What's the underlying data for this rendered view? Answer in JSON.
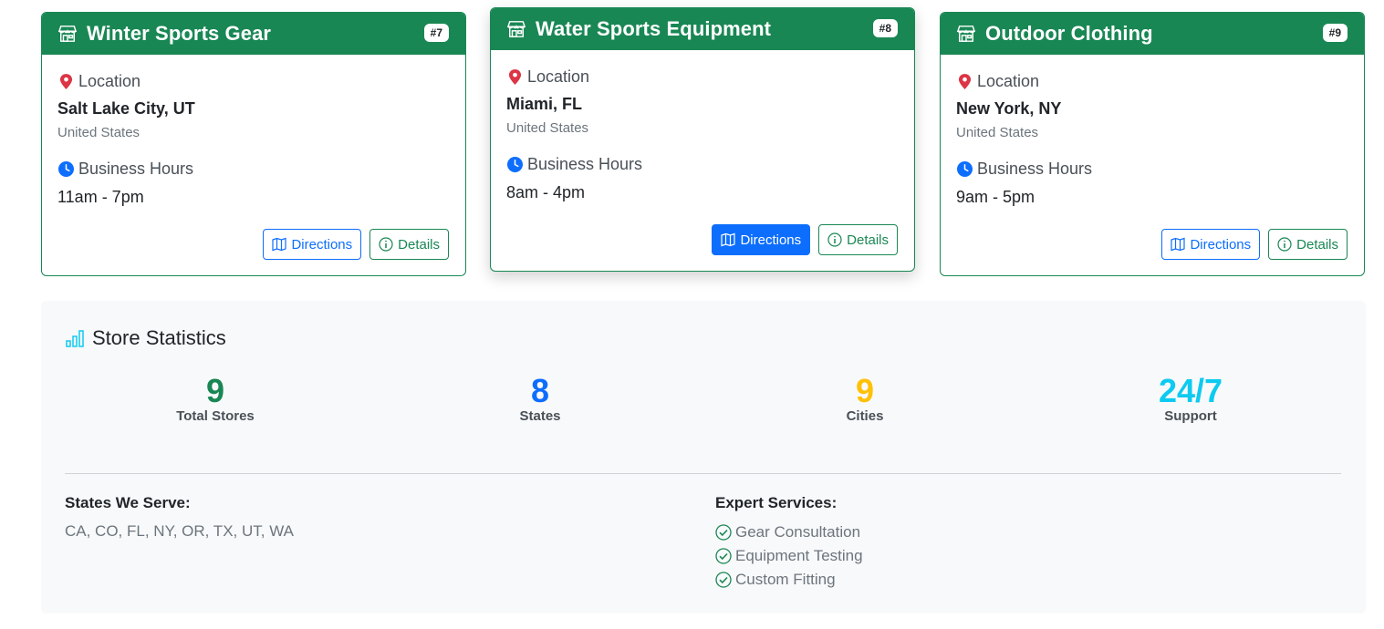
{
  "stores": [
    {
      "name": "Winter Sports Gear",
      "badge": "#7",
      "location_label": "Location",
      "city": "Salt Lake City, UT",
      "country": "United States",
      "hours_label": "Business Hours",
      "hours": "11am - 7pm",
      "directions_label": "Directions",
      "details_label": "Details"
    },
    {
      "name": "Water Sports Equipment",
      "badge": "#8",
      "location_label": "Location",
      "city": "Miami, FL",
      "country": "United States",
      "hours_label": "Business Hours",
      "hours": "8am - 4pm",
      "directions_label": "Directions",
      "details_label": "Details"
    },
    {
      "name": "Outdoor Clothing",
      "badge": "#9",
      "location_label": "Location",
      "city": "New York, NY",
      "country": "United States",
      "hours_label": "Business Hours",
      "hours": "9am - 5pm",
      "directions_label": "Directions",
      "details_label": "Details"
    }
  ],
  "statistics": {
    "title": "Store Statistics",
    "items": [
      {
        "value": "9",
        "label": "Total Stores",
        "color": "#198754"
      },
      {
        "value": "8",
        "label": "States",
        "color": "#0d6efd"
      },
      {
        "value": "9",
        "label": "Cities",
        "color": "#ffc107"
      },
      {
        "value": "24/7",
        "label": "Support",
        "color": "#0dcaf0"
      }
    ],
    "states_title": "States We Serve:",
    "states_list": "CA, CO, FL, NY, OR, TX, UT, WA",
    "services_title": "Expert Services:",
    "services": [
      "Gear Consultation",
      "Equipment Testing",
      "Custom Fitting"
    ]
  },
  "icons": {
    "store": "shop-icon",
    "location": "geo-pin-icon",
    "hours": "clock-icon",
    "directions": "map-icon",
    "details": "info-circle-icon",
    "stats": "bar-chart-icon",
    "check": "check-circle-icon"
  },
  "colors": {
    "primary_green": "#198754",
    "primary_blue": "#0d6efd",
    "pin_red": "#dc3545",
    "panel_bg": "#f8f9fa"
  }
}
